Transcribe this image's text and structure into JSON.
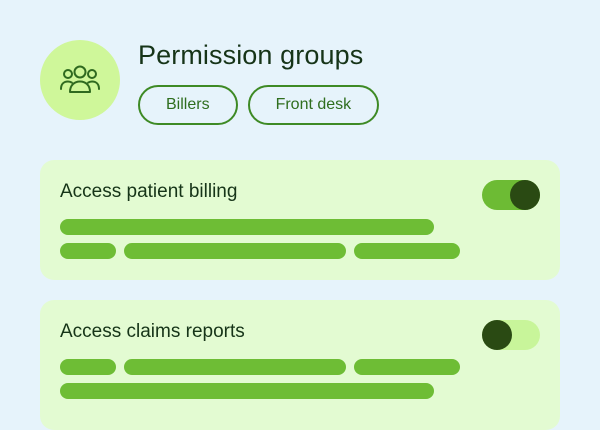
{
  "header": {
    "title": "Permission groups",
    "icon": "users-group-icon",
    "chips": [
      {
        "label": "Billers"
      },
      {
        "label": "Front desk"
      }
    ]
  },
  "permissions": [
    {
      "label": "Access patient billing",
      "enabled": true
    },
    {
      "label": "Access claims reports",
      "enabled": false
    }
  ],
  "colors": {
    "background": "#e6f3fb",
    "avatar": "#cff79a",
    "card": "#e3fbd2",
    "accent": "#6ebd35",
    "toggle_knob": "#2a4a13"
  }
}
